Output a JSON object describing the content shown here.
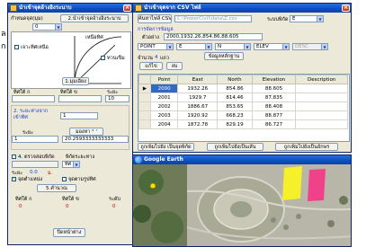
{
  "left_window": {
    "title": "นำเข้าจุดอ้างอิงระนาบ",
    "section_label": "กำหนดจุด(มุม)",
    "tab2_label": "2.นำเข้าจุดอ้างอิงระนาบ",
    "input_value": "0",
    "north_label": "เหนือทิศ",
    "check1_label": "เจาะทิศเหนือ",
    "check2_label": "ทวนเข็ม",
    "btn1_label": "1.มุมเอียง",
    "lbl_dir_a": "ทิศใต้ ก",
    "lbl_dir_b": "ทิศใต้ ข",
    "lbl_dist": "ระยะ",
    "dist_value": "10",
    "section2_label": "2. ระยะห่างจาก",
    "section2_sub": "เข้าทิศ",
    "field_a_value": "1",
    "field_b_label": "ระยะ",
    "calc_btn_label": "มองหา ° '",
    "field_c_value": "1",
    "field_d_value": "20.2593333333333",
    "check3_label": "4. ตรวจสอบพิกัด",
    "check3_sub": "พิกัดระยะทาง",
    "combo_value": "ทิศ",
    "res_label": "ระยะ",
    "res_value_1": "0.0",
    "res_unit": "ม.",
    "check4_label": "จุดตำแหน่ง",
    "check5_label": "จุดตามรูปทิศ",
    "btn_calc_label": "5.คำนวณ",
    "lbl_res_a": "ทิศใต้ ก",
    "lbl_res_b": "ทิศใต้ ข",
    "lbl_res_c": "ระดับ",
    "val_res_a": "0",
    "val_res_b": "0",
    "val_res_c": "0",
    "btn_close_label": "ปิดหน้าต่าง"
  },
  "right_window": {
    "title": "นำเข้าจุดจาก CSV ไฟล์",
    "open_file_btn": "ค้นหาไฟล์ CSV",
    "file_path": "C:\\PowerCivil\\data\\Z.csv",
    "zone_label": "ระบบพิกัด",
    "zone_value": "E",
    "sample_section_label": "การจัดการข้อมูล",
    "sample_label": "ตัวอย่าง",
    "sample_value": "2000,1932.26,854.86,88.605",
    "col_combos": [
      "POINT",
      "E",
      "N",
      "ELEV",
      "DESC"
    ],
    "import_btn": "ข้อมูลหลักฐาน",
    "count_label": "จำนวน",
    "count_value": "4",
    "count_unit": "แถว",
    "nav_btn_1": "แก้ไข",
    "nav_btn_2": "ลบ",
    "table": {
      "columns": [
        "Point",
        "East",
        "North",
        "Elevation",
        "Description"
      ],
      "rows": [
        [
          "2000",
          "1932.26",
          "854.86",
          "88.605",
          ""
        ],
        [
          "2001",
          "1929.7",
          "814.46",
          "87.835",
          ""
        ],
        [
          "2002",
          "1886.67",
          "853.65",
          "88.408",
          ""
        ],
        [
          "2003",
          "1920.92",
          "668.23",
          "88.877",
          ""
        ],
        [
          "2004",
          "1872.78",
          "829.19",
          "86.727",
          ""
        ]
      ]
    },
    "btn_bottom_1": "ถูกเพิ่มไปยัง เป็นจุดพิกัด",
    "btn_bottom_2": "ถูกเพิ่มไปยังเป็นเส้น",
    "btn_bottom_3": "ถูกเพิ่มไปยังเป็นอักษร"
  },
  "google_earth": {
    "label": "Google Earth"
  },
  "side_glyphs": {
    "g1": "ล",
    "g2": "ก"
  }
}
